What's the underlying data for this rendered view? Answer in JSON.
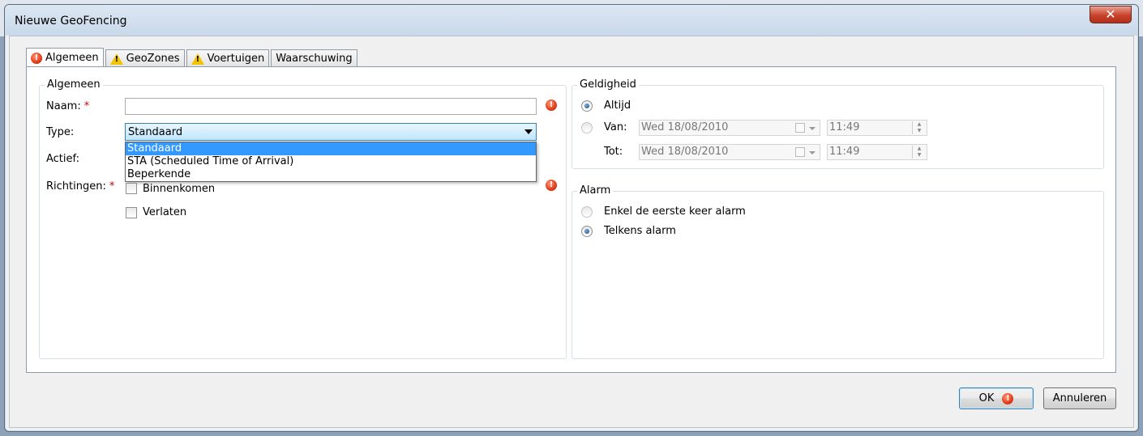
{
  "window": {
    "title": "Nieuwe GeoFencing",
    "close_glyph": "✕"
  },
  "tabs": [
    {
      "label": "Algemeen",
      "icon": "error-icon",
      "active": true
    },
    {
      "label": "GeoZones",
      "icon": "warning-icon",
      "active": false
    },
    {
      "label": "Voertuigen",
      "icon": "warning-icon",
      "active": false
    },
    {
      "label": "Waarschuwing",
      "icon": "",
      "active": false
    }
  ],
  "algemeen": {
    "group_title": "Algemeen",
    "naam_label": "Naam:",
    "naam_value": "",
    "type_label": "Type:",
    "type_value": "Standaard",
    "type_options": [
      "Standaard",
      "STA (Scheduled Time of Arrival)",
      "Beperkende"
    ],
    "actief_label": "Actief:",
    "richtingen_label": "Richtingen:",
    "required_mark": "*",
    "checkboxes": [
      {
        "label": "Binnenkomen",
        "checked": false
      },
      {
        "label": "Verlaten",
        "checked": false
      }
    ]
  },
  "geldigheid": {
    "group_title": "Geldigheid",
    "altijd_label": "Altijd",
    "van_label": "Van:",
    "tot_label": "Tot:",
    "van_date": "Wed 18/08/2010",
    "van_time": "11:49",
    "tot_date": "Wed 18/08/2010",
    "tot_time": "11:49"
  },
  "alarm": {
    "group_title": "Alarm",
    "option_first": "Enkel de eerste keer alarm",
    "option_always": "Telkens alarm"
  },
  "buttons": {
    "ok_label": "OK",
    "cancel_label": "Annuleren"
  },
  "icons": {
    "error_glyph": "!",
    "spin_up": "▲",
    "spin_down": "▼"
  }
}
